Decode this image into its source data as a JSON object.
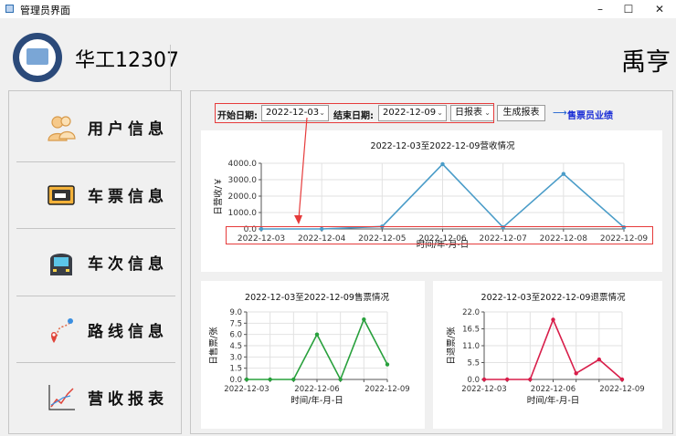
{
  "window": {
    "title": "管理员界面",
    "minimize": "–",
    "maximize": "☐",
    "close": "✕"
  },
  "header": {
    "brand": "华工12307",
    "user": "禹亨"
  },
  "sidebar": {
    "items": [
      {
        "label": "用户信息",
        "icon": "users-icon"
      },
      {
        "label": "车票信息",
        "icon": "ticket-icon"
      },
      {
        "label": "车次信息",
        "icon": "train-icon"
      },
      {
        "label": "路线信息",
        "icon": "route-icon"
      },
      {
        "label": "营收报表",
        "icon": "chart-icon"
      }
    ]
  },
  "controls": {
    "start_label": "开始日期:",
    "start_value": "2022-12-03",
    "end_label": "结束日期:",
    "end_value": "2022-12-09",
    "report_type": "日报表",
    "generate": "生成报表",
    "performance_link": "售票员业绩"
  },
  "colors": {
    "revenue": "#4a9cc8",
    "sales": "#28a03c",
    "refund": "#d81e4a",
    "annotation": "#e63b3b"
  },
  "chart_data": [
    {
      "type": "line",
      "title": "2022-12-03至2022-12-09营收情况",
      "xlabel": "时间/年-月-日",
      "ylabel": "日营收/￥",
      "x": [
        "2022-12-03",
        "2022-12-04",
        "2022-12-05",
        "2022-12-06",
        "2022-12-07",
        "2022-12-08",
        "2022-12-09"
      ],
      "y": [
        0,
        0,
        150,
        3950,
        100,
        3350,
        100
      ],
      "ylim": [
        0,
        4000
      ],
      "yticks": [
        "0.0",
        "1000.0",
        "2000.0",
        "3000.0",
        "4000.0"
      ],
      "xticks": [
        "2022-12-03",
        "2022-12-04",
        "2022-12-05",
        "2022-12-06",
        "2022-12-07",
        "2022-12-08",
        "2022-12-09"
      ],
      "grid": true
    },
    {
      "type": "line",
      "title": "2022-12-03至2022-12-09售票情况",
      "xlabel": "时间/年-月-日",
      "ylabel": "日售票/张",
      "x": [
        "2022-12-03",
        "2022-12-04",
        "2022-12-05",
        "2022-12-06",
        "2022-12-07",
        "2022-12-08",
        "2022-12-09"
      ],
      "y": [
        0,
        0,
        0,
        6,
        0,
        8,
        2
      ],
      "ylim": [
        0,
        9
      ],
      "yticks": [
        "0.0",
        "1.5",
        "3.0",
        "4.5",
        "6.0",
        "7.5",
        "9.0"
      ],
      "xticks": [
        "2022-12-03",
        "2022-12-06",
        "2022-12-09"
      ],
      "grid": true
    },
    {
      "type": "line",
      "title": "2022-12-03至2022-12-09退票情况",
      "xlabel": "时间/年-月-日",
      "ylabel": "日退票/张",
      "x": [
        "2022-12-03",
        "2022-12-04",
        "2022-12-05",
        "2022-12-06",
        "2022-12-07",
        "2022-12-08",
        "2022-12-09"
      ],
      "y": [
        0,
        0,
        0,
        19.5,
        2,
        6.5,
        0
      ],
      "ylim": [
        0,
        22
      ],
      "yticks": [
        "0.0",
        "5.5",
        "11.0",
        "16.5",
        "22.0"
      ],
      "xticks": [
        "2022-12-03",
        "2022-12-06",
        "2022-12-09"
      ],
      "grid": true
    }
  ]
}
